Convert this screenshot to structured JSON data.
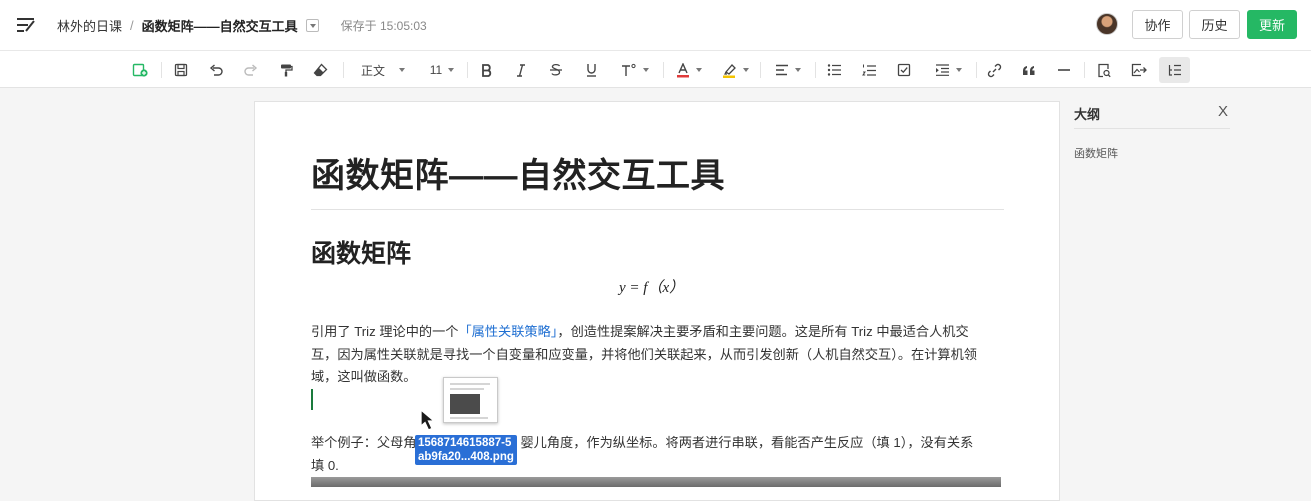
{
  "header": {
    "breadcrumb_parent": "林外的日课",
    "breadcrumb_separator": "/",
    "doc_title": "函数矩阵——自然交互工具",
    "save_status": "保存于 15:05:03",
    "collab_label": "协作",
    "history_label": "历史",
    "update_label": "更新"
  },
  "toolbar": {
    "paragraph_style": "正文",
    "font_size": "11",
    "icons": [
      "new-doc-icon",
      "save-icon",
      "undo-icon",
      "redo-icon",
      "format-painter-icon",
      "clear-format-icon",
      "bold-icon",
      "italic-icon",
      "strikethrough-icon",
      "underline-icon",
      "superscript-icon",
      "font-color-icon",
      "highlight-icon",
      "align-icon",
      "bullet-list-icon",
      "numbered-list-icon",
      "checklist-icon",
      "indent-icon",
      "link-icon",
      "quote-icon",
      "divider-icon",
      "find-icon",
      "insert-image-icon",
      "outline-icon"
    ]
  },
  "document": {
    "title": "函数矩阵——自然交互工具",
    "heading": "函数矩阵",
    "formula": "y = f（x）",
    "para1_before_link": "引用了 Triz 理论中的一个",
    "para1_link": "「属性关联策略」",
    "para1_line1_rest": "，创造性提案解决主要矛盾和主要问题。这是所有 Triz 中最适合人机交",
    "para1_line2": "互，因为属性关联就是寻找一个自变量和应变量，并将他们关联起来，从而引发创新（人机自然交互）。在计算机领",
    "para1_line3": "域，这叫做函数。",
    "para2_line1_start": "举个例子：父母角",
    "para2_line1_end": "婴儿角度，作为纵坐标。将两者进行串联，看能否产生反应（填 1），没有关系",
    "para2_line2": "填 0."
  },
  "drag": {
    "file_name_line1": "1568714615887-5",
    "file_name_line2": "ab9fa20...408.png"
  },
  "outline": {
    "title": "大纲",
    "close_label": "X",
    "items": [
      "函数矩阵"
    ]
  },
  "colors": {
    "accent_green": "#25b864",
    "link_blue": "#1f6fd2",
    "drag_label_blue": "#2a6fd6",
    "font_color_red": "#e03b3b",
    "highlight_yellow": "#f5c400"
  }
}
